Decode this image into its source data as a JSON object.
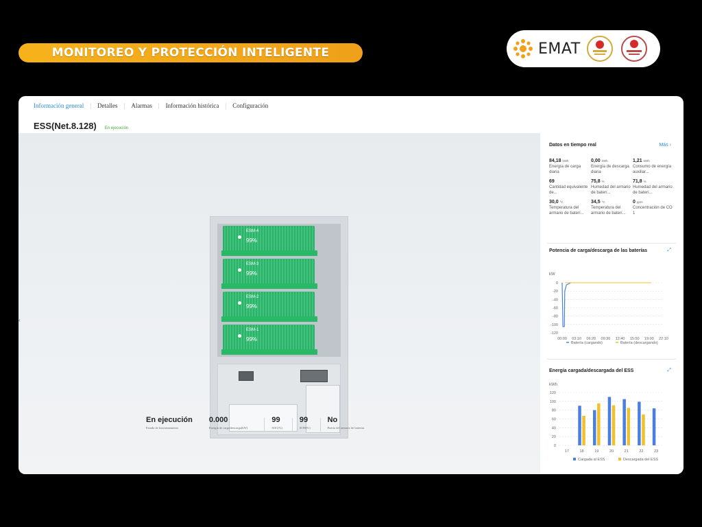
{
  "banner": {
    "title": "MONITOREO Y PROTECCIÓN INTELIGENTE"
  },
  "logo": {
    "brand": "EMAT"
  },
  "tabs": [
    {
      "label": "Información general",
      "active": true
    },
    {
      "label": "Detalles"
    },
    {
      "label": "Alarmas"
    },
    {
      "label": "Información histórica"
    },
    {
      "label": "Configuración"
    }
  ],
  "device": {
    "name": "ESS(Net.8.128)",
    "status": "En ejecución"
  },
  "modules": [
    {
      "label": "ESM-4",
      "soc": "99%"
    },
    {
      "label": "ESM-3",
      "soc": "99%"
    },
    {
      "label": "ESM-2",
      "soc": "99%"
    },
    {
      "label": "ESM-1",
      "soc": "99%"
    }
  ],
  "summary": [
    {
      "value": "En ejecución",
      "label": "Estado de funcionamiento"
    },
    {
      "value": "0.000",
      "label": "Energía de carga/descarga(kW)"
    },
    {
      "value": "99",
      "label": "SOC(%)"
    },
    {
      "value": "99",
      "label": "SOH(%)"
    },
    {
      "value": "No",
      "label": "Puerta del armario de baterías"
    }
  ],
  "realtime": {
    "title": "Datos en tiempo real",
    "more": "Más",
    "metrics": [
      {
        "value": "84,18",
        "unit": "kWh",
        "label": "Energía de carga diaria"
      },
      {
        "value": "0,00",
        "unit": "kWh",
        "label": "Energía de descarga diaria"
      },
      {
        "value": "1,21",
        "unit": "kWh",
        "label": "Consumo de energía auxiliar..."
      },
      {
        "value": "69",
        "unit": "",
        "label": "Cantidad equivalente de..."
      },
      {
        "value": "75,8",
        "unit": "%",
        "label": "Humedad del armario de baterí..."
      },
      {
        "value": "71,8",
        "unit": "%",
        "label": "Humedad del armario de baterí..."
      },
      {
        "value": "30,0",
        "unit": "°C",
        "label": "Temperatura del armario de baterí..."
      },
      {
        "value": "34,5",
        "unit": "°C",
        "label": "Temperatura del armario de baterí..."
      },
      {
        "value": "0",
        "unit": "ppm",
        "label": "Concentración de CO 1"
      }
    ]
  },
  "colors": {
    "accent": "#2c8bd8",
    "green": "#3ab03e",
    "charge": "#4a7fe0",
    "discharge": "#f2c029",
    "module": "#2fb06a"
  },
  "chart_data": [
    {
      "type": "line",
      "title": "Potencia de carga/descarga de las baterías",
      "ylabel": "kW",
      "ylim": [
        -120,
        0
      ],
      "yticks": [
        0,
        -20,
        -40,
        -60,
        -80,
        -100,
        -120
      ],
      "x": [
        "00:00",
        "03:10",
        "06:20",
        "09:30",
        "12:40",
        "15:50",
        "19:00",
        "22:10"
      ],
      "grid": true,
      "legend": "bottom",
      "series": [
        {
          "name": "Batería (cargando)",
          "color": "#4a7fe0",
          "points": [
            [
              0,
              0
            ],
            [
              0.05,
              -105
            ],
            [
              0.15,
              -105
            ],
            [
              0.18,
              -20
            ],
            [
              0.3,
              -5
            ],
            [
              0.6,
              0
            ]
          ]
        },
        {
          "name": "Batería (descargando)",
          "color": "#f2c029",
          "points": [
            [
              0.2,
              0
            ],
            [
              6.15,
              0
            ]
          ]
        }
      ]
    },
    {
      "type": "bar",
      "title": "Energía cargada/descargada del ESS",
      "ylabel": "kWh",
      "ylim": [
        0,
        120
      ],
      "yticks": [
        0,
        20,
        40,
        60,
        80,
        100,
        120
      ],
      "categories": [
        "17",
        "18",
        "19",
        "20",
        "21",
        "22",
        "23"
      ],
      "grid": true,
      "legend": "bottom",
      "series": [
        {
          "name": "Cargada al ESS",
          "color": "#4a7fe0",
          "values": [
            null,
            90,
            80,
            110,
            105,
            99,
            84
          ]
        },
        {
          "name": "Descargada del ESS",
          "color": "#f2c029",
          "values": [
            null,
            67,
            95,
            91,
            85,
            70,
            null
          ]
        }
      ]
    }
  ]
}
